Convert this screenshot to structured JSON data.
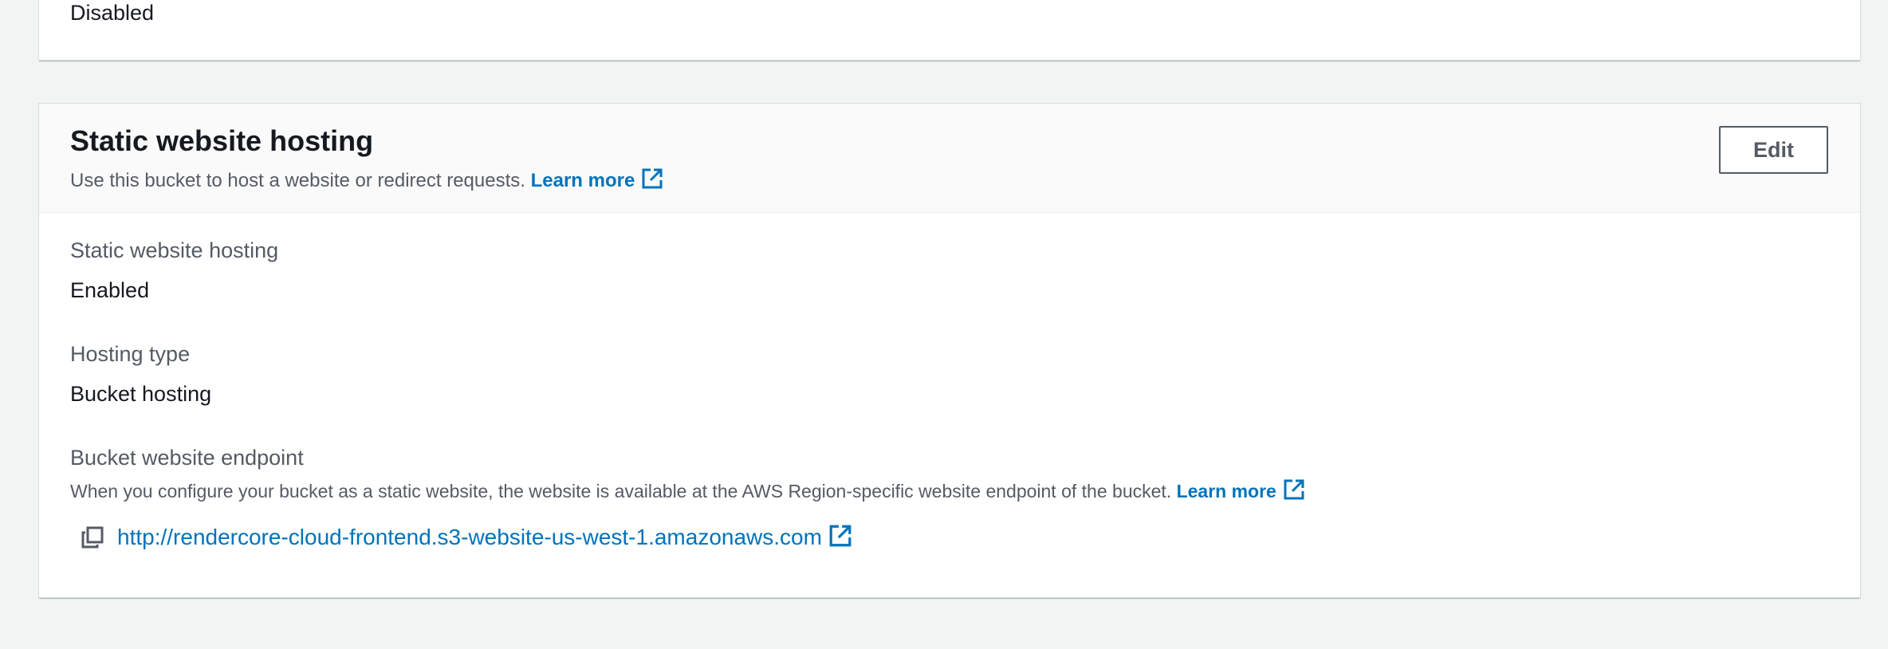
{
  "previous_section": {
    "value": "Disabled"
  },
  "static_website_hosting": {
    "title": "Static website hosting",
    "description": "Use this bucket to host a website or redirect requests.",
    "learn_more_label": "Learn more",
    "edit_label": "Edit",
    "fields": {
      "hosting_status": {
        "label": "Static website hosting",
        "value": "Enabled"
      },
      "hosting_type": {
        "label": "Hosting type",
        "value": "Bucket hosting"
      },
      "endpoint": {
        "label": "Bucket website endpoint",
        "description": "When you configure your bucket as a static website, the website is available at the AWS Region-specific website endpoint of the bucket.",
        "learn_more_label": "Learn more",
        "url": "http://rendercore-cloud-frontend.s3-website-us-west-1.amazonaws.com"
      }
    }
  },
  "colors": {
    "link": "#0073bb",
    "text_primary": "#16191f",
    "text_secondary": "#545b64",
    "background": "#f2f3f3"
  },
  "icons": {
    "external_link": "external-link-icon",
    "copy": "copy-icon"
  }
}
